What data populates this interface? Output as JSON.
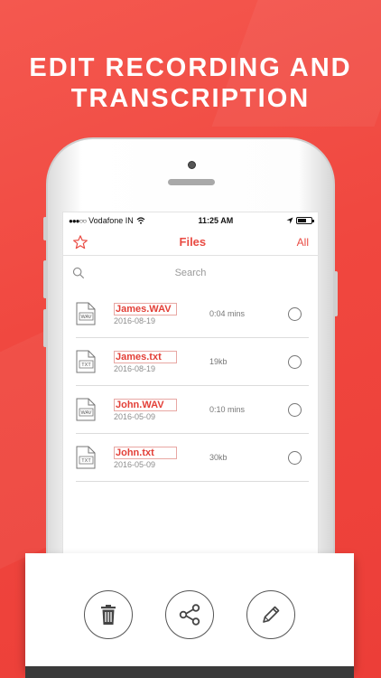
{
  "headline": {
    "line1": "EDIT RECORDING AND",
    "line2": "TRANSCRIPTION"
  },
  "statusbar": {
    "carrier": "Vodafone IN",
    "time": "11:25 AM"
  },
  "navbar": {
    "title": "Files",
    "right_label": "All",
    "left_icon": "star-icon"
  },
  "search": {
    "placeholder": "Search"
  },
  "files": [
    {
      "name": "James.WAV",
      "date": "2016-08-19",
      "info": "0:04 mins",
      "type": "WAV"
    },
    {
      "name": "James.txt",
      "date": "2016-08-19",
      "info": "19kb",
      "type": "TXT"
    },
    {
      "name": "John.WAV",
      "date": "2016-05-09",
      "info": "0:10 mins",
      "type": "WAV"
    },
    {
      "name": "John.txt",
      "date": "2016-05-09",
      "info": "30kb",
      "type": "TXT"
    }
  ],
  "toolbar": {
    "icons": [
      "trash-icon",
      "share-icon",
      "pencil-icon"
    ]
  },
  "colors": {
    "accent": "#e94b43",
    "background": "#f0473f"
  }
}
